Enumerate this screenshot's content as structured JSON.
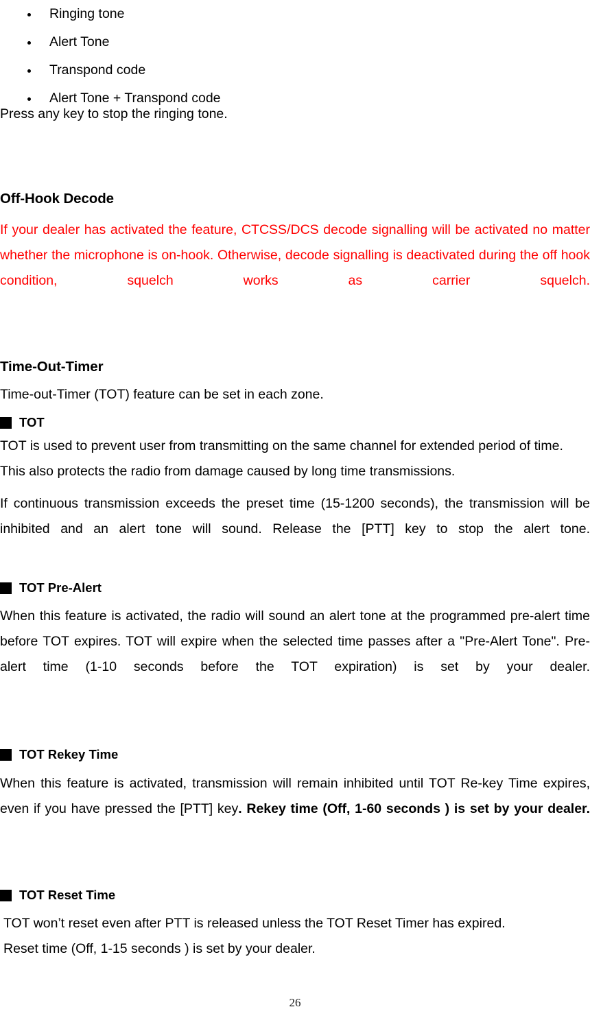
{
  "document": {
    "page_number": "26"
  },
  "tone_options": {
    "items": [
      {
        "label": "Ringing tone"
      },
      {
        "label": "Alert Tone"
      },
      {
        "label": "Transpond code"
      },
      {
        "label": "Alert Tone + Transpond code"
      }
    ],
    "note": "Press any key to stop the ringing tone."
  },
  "off_hook_decode": {
    "heading": "Off-Hook Decode",
    "body": "If your dealer has activated the feature, CTCSS/DCS decode signalling will be activated no matter whether the microphone is on-hook. Otherwise, decode signalling is deactivated during the off hook condition, squelch works as carrier squelch.",
    "body_color": "#ff0000"
  },
  "time_out_timer": {
    "heading": "Time-Out-Timer",
    "intro": "Time-out-Timer (TOT) feature can be set in each zone.",
    "sections": [
      {
        "marker": "filled-square",
        "title": "TOT",
        "paragraphs": [
          "TOT is used to prevent user from transmitting on the same channel for extended period of time. This also protects the radio from damage caused by long time transmissions.",
          "If continuous transmission exceeds the preset time (15-1200 seconds), the transmission will be inhibited and an alert tone will sound. Release the [PTT] key to stop the alert tone."
        ]
      },
      {
        "marker": "filled-square",
        "title": "TOT Pre-Alert",
        "paragraphs": [
          "When this feature is activated, the radio will sound an alert tone at the programmed pre-alert time before TOT expires. TOT will expire when the selected time passes after a \"Pre-Alert Tone\". Pre-alert time (1-10 seconds before the TOT expiration) is set by your dealer."
        ]
      },
      {
        "marker": "filled-square",
        "title": "TOT Rekey Time",
        "paragraphs": [
          "When this feature is activated, transmission will remain inhibited until TOT Re-key Time expires, even if you have pressed the [PTT] key",
          ". Rekey time (Off, 1-60 seconds ) is set by your dealer."
        ]
      },
      {
        "marker": "filled-square",
        "title": "TOT Reset Time",
        "paragraphs": [
          "TOT won’t reset even after PTT is released unless the TOT Reset Timer has expired.",
          "Reset time (Off, 1-15 seconds ) is set by your dealer."
        ]
      }
    ]
  }
}
